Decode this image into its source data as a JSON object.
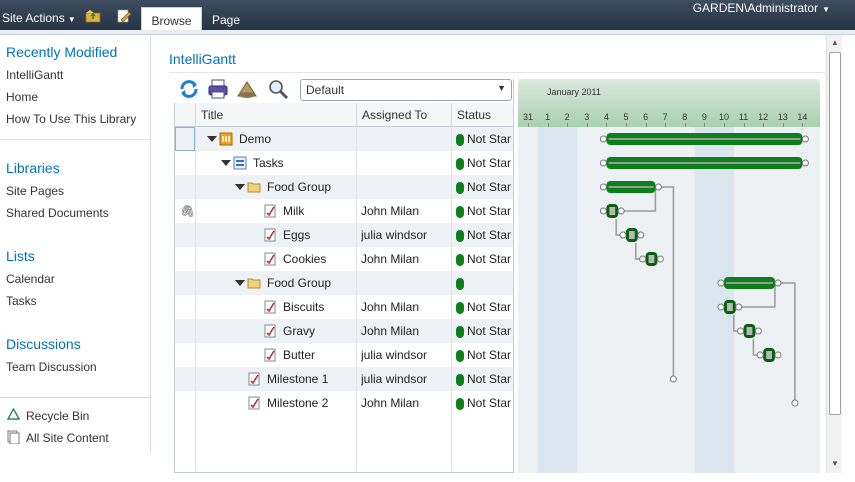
{
  "ribbon": {
    "site_actions": "Site Actions",
    "tabs": [
      {
        "label": "Browse"
      },
      {
        "label": "Page"
      }
    ],
    "user": "GARDEN\\Administrator"
  },
  "nav": {
    "recently_modified": {
      "heading": "Recently Modified",
      "items": [
        "IntelliGantt",
        "Home",
        "How To Use This Library"
      ]
    },
    "libraries": {
      "heading": "Libraries",
      "items": [
        "Site Pages",
        "Shared Documents"
      ]
    },
    "lists": {
      "heading": "Lists",
      "items": [
        "Calendar",
        "Tasks"
      ]
    },
    "discussions": {
      "heading": "Discussions",
      "items": [
        "Team Discussion"
      ]
    },
    "recycle_bin": "Recycle Bin",
    "all_site_content": "All Site Content"
  },
  "page_title": "IntelliGantt",
  "view_select": "Default",
  "grid": {
    "columns": [
      "Title",
      "Assigned To",
      "Status"
    ],
    "rows": [
      {
        "title": "Demo",
        "assigned": "",
        "status": "Not Star",
        "icon": "demo-project-icon",
        "level": 0,
        "expander": true
      },
      {
        "title": "Tasks",
        "assigned": "",
        "status": "Not Star",
        "icon": "task-list-icon",
        "level": 1,
        "expander": true
      },
      {
        "title": "Food Group",
        "assigned": "",
        "status": "Not Star",
        "icon": "folder-icon",
        "level": 2,
        "expander": true
      },
      {
        "title": "Milk",
        "assigned": "John Milan",
        "status": "Not Star",
        "icon": "task-icon",
        "level": 3,
        "attachment": true
      },
      {
        "title": "Eggs",
        "assigned": "julia windsor",
        "status": "Not Star",
        "icon": "task-icon",
        "level": 3
      },
      {
        "title": "Cookies",
        "assigned": "John Milan",
        "status": "Not Star",
        "icon": "task-icon",
        "level": 3
      },
      {
        "title": "Food Group",
        "assigned": "",
        "status": "",
        "icon": "folder-icon",
        "level": 2,
        "expander": true
      },
      {
        "title": "Biscuits",
        "assigned": "John Milan",
        "status": "Not Star",
        "icon": "task-icon",
        "level": 3
      },
      {
        "title": "Gravy",
        "assigned": "John Milan",
        "status": "Not Star",
        "icon": "task-icon",
        "level": 3
      },
      {
        "title": "Butter",
        "assigned": "julia windsor",
        "status": "Not Star",
        "icon": "task-icon",
        "level": 3
      },
      {
        "title": "Milestone 1",
        "assigned": "julia windsor",
        "status": "Not Star",
        "icon": "task-icon",
        "level": 2
      },
      {
        "title": "Milestone 2",
        "assigned": "John Milan",
        "status": "Not Star",
        "icon": "task-icon",
        "level": 2
      }
    ]
  },
  "gantt": {
    "month": "January 2011",
    "days": [
      "31",
      "1",
      "2",
      "3",
      "4",
      "5",
      "6",
      "7",
      "8",
      "9",
      "10",
      "11",
      "12",
      "13",
      "14",
      "1"
    ],
    "bars": [
      {
        "row": 0,
        "type": "summary",
        "start": 4,
        "end": 14
      },
      {
        "row": 1,
        "type": "summary",
        "start": 4,
        "end": 14
      },
      {
        "row": 2,
        "type": "summary",
        "start": 4,
        "end": 6.5
      },
      {
        "row": 3,
        "type": "task",
        "start": 4,
        "end": 4.6
      },
      {
        "row": 4,
        "type": "task",
        "start": 5,
        "end": 5.6
      },
      {
        "row": 5,
        "type": "task",
        "start": 6,
        "end": 6.6
      },
      {
        "row": 6,
        "type": "summary",
        "start": 10,
        "end": 12.6
      },
      {
        "row": 7,
        "type": "task",
        "start": 10,
        "end": 10.6
      },
      {
        "row": 8,
        "type": "task",
        "start": 11,
        "end": 11.6
      },
      {
        "row": 9,
        "type": "task",
        "start": 12,
        "end": 12.6
      }
    ],
    "colors": {
      "bar": "#0a7f1a",
      "bar_dark": "#06600f",
      "band": "#dbe6ef",
      "grid_bg": "#eef1f4"
    }
  }
}
